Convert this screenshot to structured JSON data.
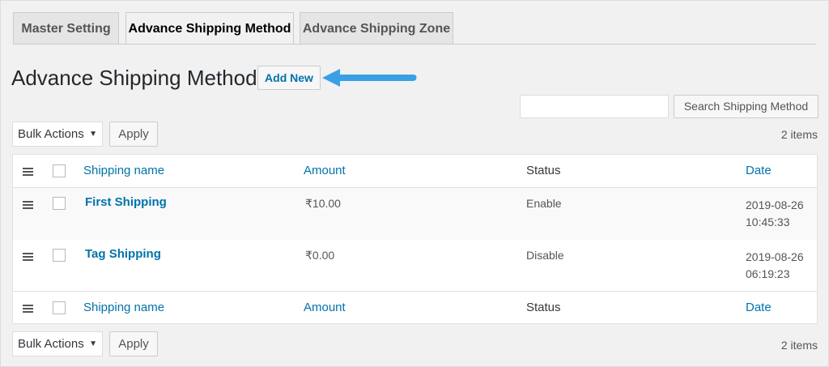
{
  "tabs": [
    {
      "label": "Master Setting",
      "active": false
    },
    {
      "label": "Advance Shipping Method",
      "active": true
    },
    {
      "label": "Advance Shipping Zone",
      "active": false
    }
  ],
  "page": {
    "title": "Advance Shipping Method",
    "add_new_label": "Add New"
  },
  "search": {
    "value": "",
    "button_label": "Search Shipping Method"
  },
  "bulk": {
    "top": {
      "selected": "Bulk Actions",
      "apply_label": "Apply",
      "items_count": "2 items"
    },
    "bottom": {
      "selected": "Bulk Actions",
      "apply_label": "Apply",
      "items_count": "2 items"
    }
  },
  "table": {
    "columns": [
      "Shipping name",
      "Amount",
      "Status",
      "Date"
    ],
    "rows": [
      {
        "name": "First Shipping",
        "amount": "₹10.00",
        "status": "Enable",
        "date": "2019-08-26",
        "time": "10:45:33"
      },
      {
        "name": "Tag Shipping",
        "amount": "₹0.00",
        "status": "Disable",
        "date": "2019-08-26",
        "time": "06:19:23"
      }
    ]
  },
  "colors": {
    "link": "#0073aa",
    "arrow": "#3aa0e6",
    "background": "#f1f1f1"
  },
  "icons": {
    "drag_handle": "drag-handle-icon",
    "arrow": "pointer-arrow-icon",
    "caret": "caret-down-icon"
  }
}
